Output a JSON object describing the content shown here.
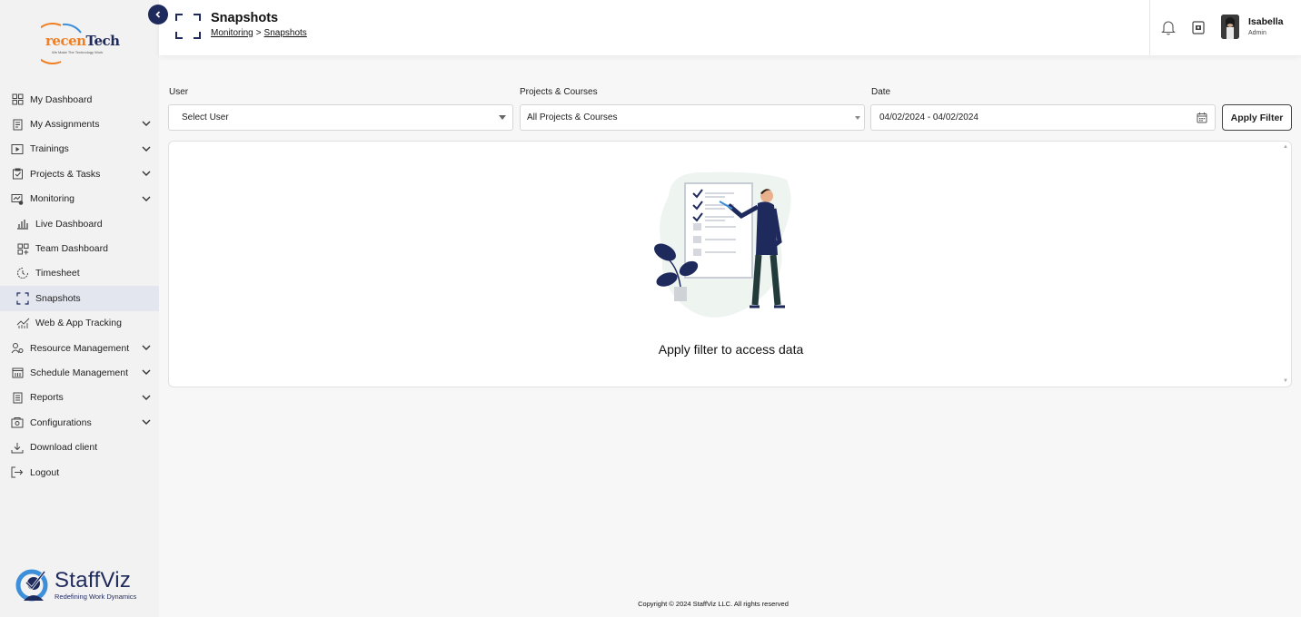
{
  "brand": {
    "logo_text": "recenTech",
    "logo_tagline": "We Make The Technology Work",
    "footer_brand": "StaffViz",
    "footer_tagline": "Redefining Work Dynamics"
  },
  "sidebar": {
    "items": [
      {
        "label": "My Dashboard",
        "icon": "dashboard-icon",
        "chevron": false
      },
      {
        "label": "My Assignments",
        "icon": "assignments-icon",
        "chevron": true
      },
      {
        "label": "Trainings",
        "icon": "trainings-icon",
        "chevron": true
      },
      {
        "label": "Projects & Tasks",
        "icon": "projects-icon",
        "chevron": true
      },
      {
        "label": "Monitoring",
        "icon": "monitoring-icon",
        "chevron": true
      },
      {
        "label": "Live Dashboard",
        "icon": "bar-chart-icon",
        "sub": true
      },
      {
        "label": "Team Dashboard",
        "icon": "grid-plus-icon",
        "sub": true
      },
      {
        "label": "Timesheet",
        "icon": "clock-icon",
        "sub": true
      },
      {
        "label": "Snapshots",
        "icon": "snapshot-frame-icon",
        "sub": true,
        "active": true
      },
      {
        "label": "Web & App Tracking",
        "icon": "tracking-chart-icon",
        "sub": true
      },
      {
        "label": "Resource Management",
        "icon": "resource-icon",
        "chevron": true
      },
      {
        "label": "Schedule Management",
        "icon": "calendar-icon",
        "chevron": true
      },
      {
        "label": "Reports",
        "icon": "report-icon",
        "chevron": true
      },
      {
        "label": "Configurations",
        "icon": "config-icon",
        "chevron": true
      },
      {
        "label": "Download client",
        "icon": "download-icon",
        "chevron": false
      },
      {
        "label": "Logout",
        "icon": "logout-icon",
        "chevron": false
      }
    ]
  },
  "header": {
    "title": "Snapshots",
    "breadcrumb": [
      "Monitoring",
      "Snapshots"
    ],
    "breadcrumb_sep": ">",
    "user": {
      "name": "Isabella",
      "role": "Admin"
    }
  },
  "filters": {
    "user": {
      "label": "User",
      "value": "Select User"
    },
    "projects": {
      "label": "Projects & Courses",
      "value": "All Projects & Courses"
    },
    "date": {
      "label": "Date",
      "value": "04/02/2024 - 04/02/2024"
    },
    "apply_label": "Apply Filter"
  },
  "content": {
    "empty_message": "Apply filter to access data"
  },
  "footer": {
    "copyright": "Copyright © 2024 StaffViz LLC. All rights reserved"
  },
  "colors": {
    "primary": "#1f2a5c",
    "accent_orange": "#f07f23",
    "active_bg": "#e4e6ef"
  }
}
